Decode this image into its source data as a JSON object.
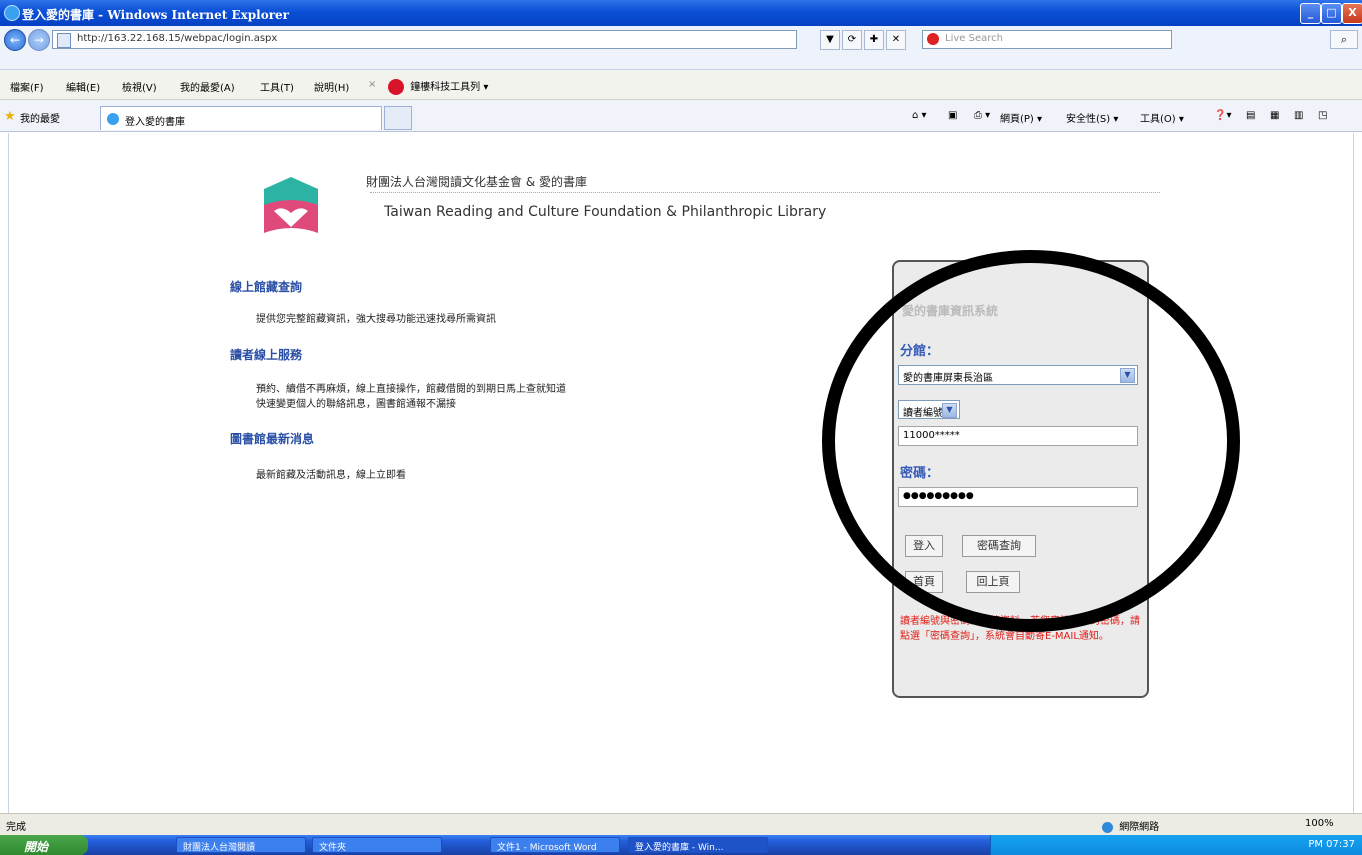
{
  "window": {
    "title": "登入愛的書庫 - Windows Internet Explorer",
    "btn_min": "_",
    "btn_max": "□",
    "btn_close": "X"
  },
  "addressbar": {
    "url": "http://163.22.168.15/webpac/login.aspx",
    "search_placeholder": "Live Search",
    "back_icon": "←",
    "forward_icon": "→",
    "tools": [
      "▼",
      "⟳",
      "✚",
      "✕"
    ]
  },
  "menubar": {
    "items": [
      "檔案(F)",
      "編輯(E)",
      "檢視(V)",
      "我的最愛(A)",
      "工具(T)",
      "說明(H)"
    ],
    "toolbar_title": "鐘樓科技工具列 ▾"
  },
  "favbar": {
    "label": "我的最愛",
    "tab_title": "登入愛的書庫",
    "commands": [
      "網頁(P) ▾",
      "安全性(S) ▾",
      "工具(O) ▾"
    ]
  },
  "header": {
    "org_zh": "財團法人台灣閱讀文化基金會 & 愛的書庫",
    "org_en": "Taiwan Reading and Culture Foundation & Philanthropic Library"
  },
  "sections": [
    {
      "title": "線上館藏查詢",
      "lines": [
        "提供您完整館藏資訊，強大搜尋功能迅速找尋所需資訊"
      ]
    },
    {
      "title": "讀者線上服務",
      "lines": [
        "預約、續借不再麻煩，線上直接操作，館藏借閱的到期日馬上查就知道",
        "快速變更個人的聯絡訊息，圖書館通報不漏接"
      ]
    },
    {
      "title": "圖書館最新消息",
      "lines": [
        "最新館藏及活動訊息，線上立即看"
      ]
    }
  ],
  "login": {
    "panel_title": "愛的書庫資訊系統",
    "branch_label": "分館：",
    "branch_value": "愛的書庫屏東長治區",
    "idtype_value": "讀者編號",
    "id_value": "11000*****",
    "password_label": "密碼：",
    "password_value": "●●●●●●●●●",
    "login_button": "登入",
    "forgot_button": "密碼查詢",
    "home_button": "首頁",
    "back_button": "回上頁",
    "notice": "讀者編號與密碼為必填資料，若您忘記自己的密碼，請點選「密碼查詢」，系統會自動寄E-MAIL通知。"
  },
  "statusbar": {
    "status": "完成",
    "zone": "網際網路",
    "zoom": "100%"
  },
  "taskbar": {
    "start": "開始",
    "tasks": [
      "財團法人台灣閱讀",
      "文件夾",
      "文件1 - Microsoft Word",
      "登入愛的書庫 - Win..."
    ],
    "clock": "PM 07:37"
  },
  "colors": {
    "link_blue": "#2a4fa6",
    "notice_red": "#e0201a",
    "title_blue": "#0a4fd6"
  }
}
